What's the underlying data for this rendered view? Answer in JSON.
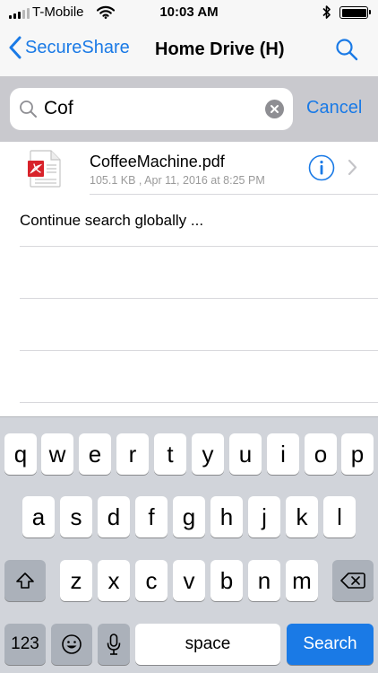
{
  "status_bar": {
    "carrier": "T-Mobile",
    "time": "10:03 AM",
    "signal_bars": 5,
    "signal_bars_active": 3
  },
  "nav": {
    "back_label": "SecureShare",
    "title": "Home Drive (H)"
  },
  "search": {
    "value": "Cof",
    "cancel_label": "Cancel"
  },
  "results": [
    {
      "name": "CoffeeMachine.pdf",
      "meta": "105.1 KB , Apr 11, 2016 at 8:25 PM"
    }
  ],
  "global_search_label": "Continue search globally ...",
  "keyboard": {
    "row1": [
      "q",
      "w",
      "e",
      "r",
      "t",
      "y",
      "u",
      "i",
      "o",
      "p"
    ],
    "row2": [
      "a",
      "s",
      "d",
      "f",
      "g",
      "h",
      "j",
      "k",
      "l"
    ],
    "row3": [
      "z",
      "x",
      "c",
      "v",
      "b",
      "n",
      "m"
    ],
    "numbers_label": "123",
    "space_label": "space",
    "search_label": "Search"
  },
  "colors": {
    "accent": "#1a7ae6",
    "pdf_red": "#d8222a",
    "keyboard_bg": "#d1d4da"
  },
  "icons": [
    "signal-icon",
    "wifi-icon",
    "bluetooth-icon",
    "battery-icon",
    "back-chevron-icon",
    "search-icon",
    "clear-icon",
    "pdf-file-icon",
    "info-icon",
    "chevron-right-icon",
    "shift-icon",
    "delete-icon",
    "emoji-icon",
    "microphone-icon"
  ]
}
